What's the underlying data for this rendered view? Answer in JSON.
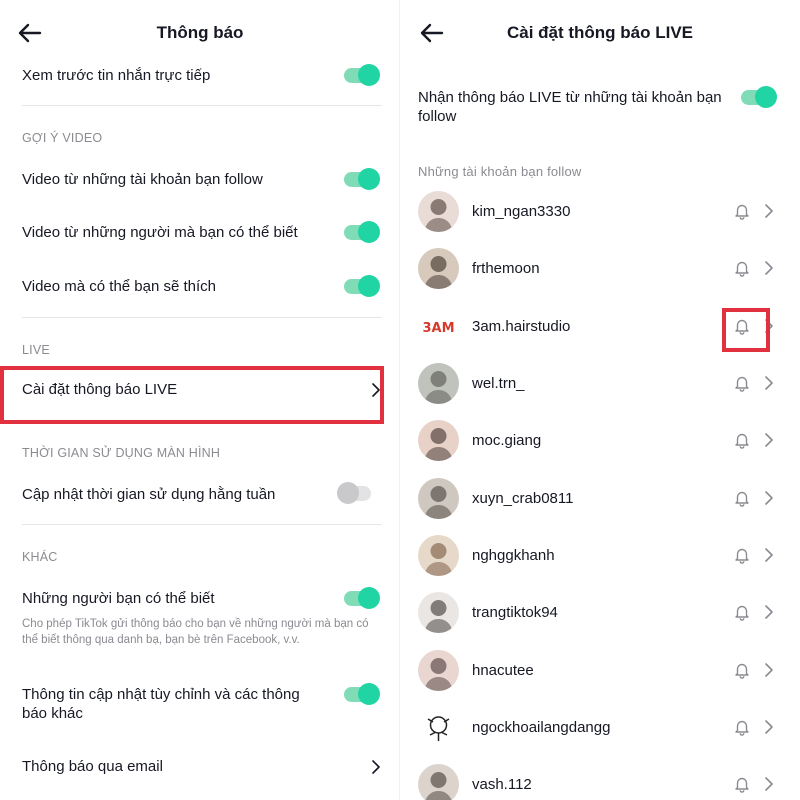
{
  "colors": {
    "accent": "#20d5a3",
    "highlight": "#e1303e",
    "secondary_text": "#8a8b91"
  },
  "left": {
    "title": "Thông báo",
    "direct_message_preview": "Xem trước tin nhắn trực tiếp",
    "section_video": "GỢI Ý VIDEO",
    "video_following": "Video từ những tài khoản bạn follow",
    "video_people_you_may_know": "Video từ những người mà bạn có thể biết",
    "video_you_may_like": "Video mà có thể bạn sẽ thích",
    "section_live": "LIVE",
    "live_settings": "Cài đặt thông báo LIVE",
    "section_screen_time": "THỜI GIAN SỬ DỤNG MÀN HÌNH",
    "weekly_screen_time": "Cập nhật thời gian sử dụng hằng tuần",
    "section_other": "KHÁC",
    "people_you_may_know": "Những người bạn có thể biết",
    "people_you_may_know_desc": "Cho phép TikTok gửi thông báo cho bạn về những người mà bạn có thể biết thông qua danh bạ, bạn bè trên Facebook, v.v.",
    "custom_updates_line1": "Thông tin cập nhật tùy chỉnh và các thông",
    "custom_updates_line2": "báo khác",
    "email_notifications": "Thông báo qua email",
    "toggles": {
      "direct_message_preview": true,
      "video_following": true,
      "video_people_you_may_know": true,
      "video_you_may_like": true,
      "weekly_screen_time": false,
      "people_you_may_know": true,
      "custom_updates": true
    }
  },
  "right": {
    "title": "Cài đặt thông báo LIVE",
    "receive_live_line1": "Nhận thông báo LIVE từ những tài khoản bạn",
    "receive_live_line2": "follow",
    "receive_live_on": true,
    "following_header": "Những tài khoản bạn follow",
    "accounts": [
      {
        "username": "kim_ngan3330",
        "icon": "bell-icon"
      },
      {
        "username": "frthemoon",
        "icon": "bell-icon"
      },
      {
        "username": "3am.hairstudio",
        "icon": "bell-icon",
        "highlighted": true
      },
      {
        "username": "wel.trn_",
        "icon": "bell-icon"
      },
      {
        "username": "moc.giang",
        "icon": "bell-icon"
      },
      {
        "username": "xuyn_crab0811",
        "icon": "bell-icon"
      },
      {
        "username": "nghggkhanh",
        "icon": "bell-icon"
      },
      {
        "username": "trangtiktok94",
        "icon": "bell-icon"
      },
      {
        "username": "hnacutee",
        "icon": "bell-icon"
      },
      {
        "username": "ngockhoailangdangg",
        "icon": "bell-icon"
      },
      {
        "username": "vash.112",
        "icon": "bell-icon"
      }
    ],
    "avatar_logo_text": "3AM"
  }
}
